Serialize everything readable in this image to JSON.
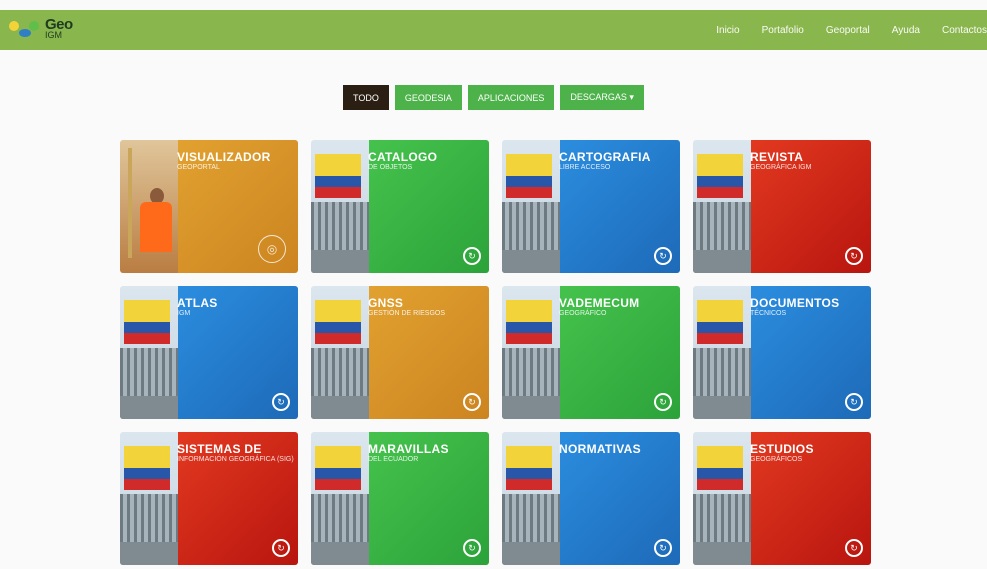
{
  "header": {
    "logo_text": "Geo",
    "logo_sub": "IGM",
    "nav": [
      "Inicio",
      "Portafolio",
      "Geoportal",
      "Ayuda",
      "Contactos"
    ]
  },
  "filters": [
    {
      "label": "TODO",
      "active": true
    },
    {
      "label": "GEODESIA",
      "active": false
    },
    {
      "label": "APLICACIONES",
      "active": false
    },
    {
      "label": "DESCARGAS ▾",
      "active": false
    }
  ],
  "tiles": [
    {
      "title": "VISUALIZADOR",
      "subtitle": "GEOPORTAL",
      "color": "orange",
      "photo": "person"
    },
    {
      "title": "CATALOGO",
      "subtitle": "DE OBJETOS",
      "color": "green"
    },
    {
      "title": "CARTOGRAFIA",
      "subtitle": "LIBRE ACCESO",
      "color": "blue"
    },
    {
      "title": "REVISTA",
      "subtitle": "GEOGRÁFICA IGM",
      "color": "red"
    },
    {
      "title": "ATLAS",
      "subtitle": "IGM",
      "color": "blue"
    },
    {
      "title": "GNSS",
      "subtitle": "GESTIÓN DE RIESGOS",
      "color": "orange"
    },
    {
      "title": "VADEMECUM",
      "subtitle": "GEOGRÁFICO",
      "color": "green"
    },
    {
      "title": "DOCUMENTOS",
      "subtitle": "TÉCNICOS",
      "color": "blue"
    },
    {
      "title": "SISTEMAS DE",
      "subtitle": "INFORMACIÓN GEOGRÁFICA (SIG)",
      "color": "red"
    },
    {
      "title": "MARAVILLAS",
      "subtitle": "DEL ECUADOR",
      "color": "green"
    },
    {
      "title": "NORMATIVAS",
      "subtitle": "",
      "color": "blue"
    },
    {
      "title": "ESTUDIOS",
      "subtitle": "GEOGRÁFICOS",
      "color": "red"
    }
  ],
  "colors": {
    "header": "#8ab64e",
    "filter_active": "#2b1f14",
    "filter_green": "#4db24a"
  }
}
